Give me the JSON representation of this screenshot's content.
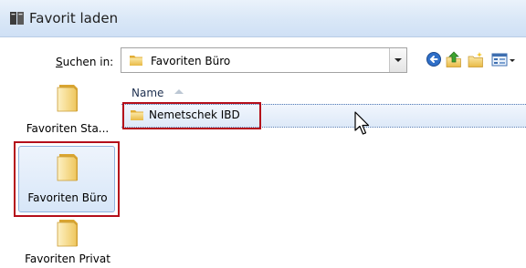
{
  "window": {
    "title": "Favorit laden"
  },
  "lookin": {
    "label_underlined": "S",
    "label_rest": "uchen in:",
    "selected_value": "Favoriten Büro"
  },
  "toolbar": {
    "icons": [
      "back-icon",
      "up-folder-icon",
      "new-folder-icon",
      "view-menu-icon"
    ]
  },
  "sidebar": {
    "items": [
      {
        "label": "Favoriten Sta...",
        "selected": false
      },
      {
        "label": "Favoriten Büro",
        "selected": true
      },
      {
        "label": "Favoriten Privat",
        "selected": false
      }
    ]
  },
  "list": {
    "column_header": "Name",
    "rows": [
      {
        "name": "Nemetschek IBD",
        "selected": true
      }
    ]
  },
  "colors": {
    "highlight_border": "#b50e1a",
    "selection_fill": "#dde9f8",
    "titlebar": "#d9e7f7"
  }
}
